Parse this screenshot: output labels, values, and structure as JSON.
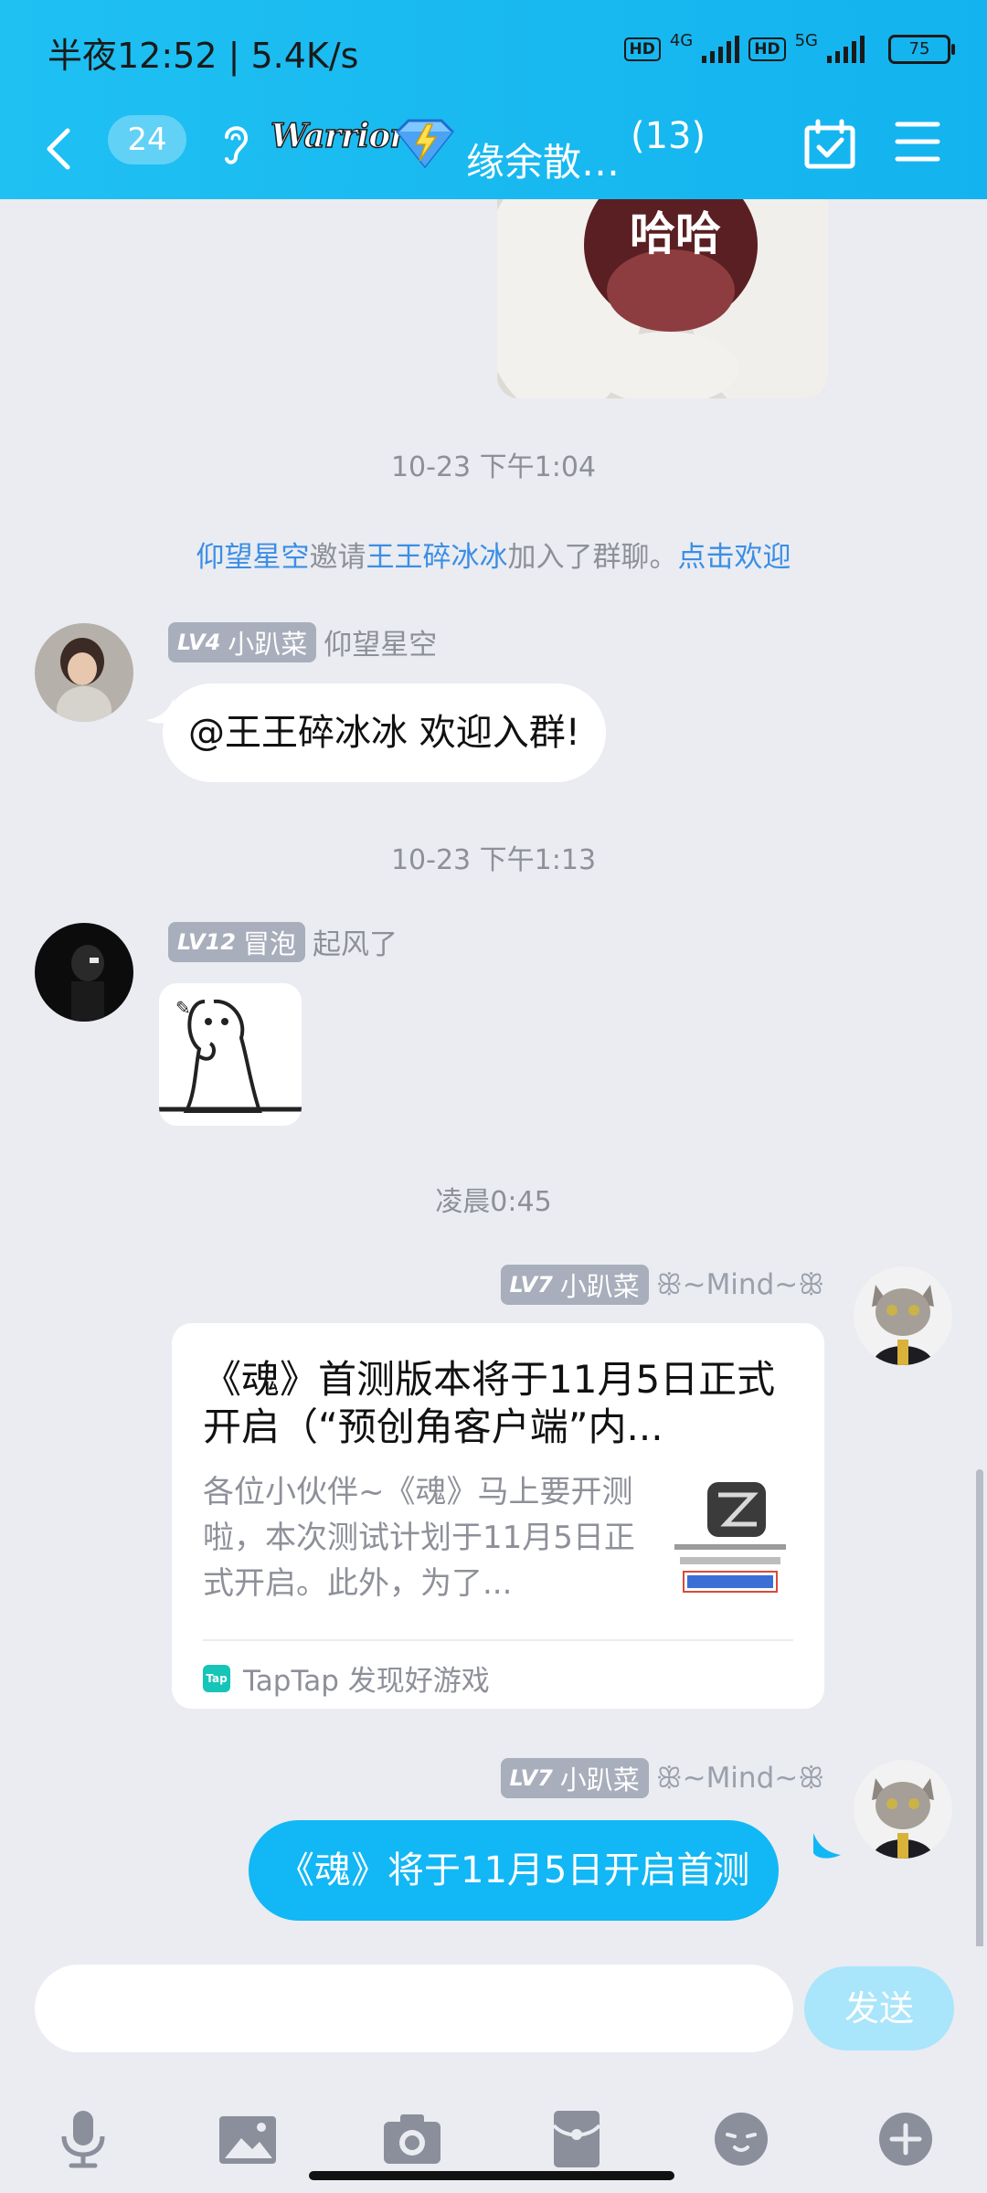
{
  "status_bar": {
    "time": "半夜12:52 | 5.4K/s",
    "hd1": "HD",
    "net1": "4G",
    "hd2": "HD",
    "net2": "5G",
    "battery": "75"
  },
  "header": {
    "unread_count": "24",
    "logo_text": "Warrior",
    "title": "缘余散…",
    "member_count": "(13)"
  },
  "chat": {
    "top_image_caption": "哈哈",
    "timestamp_1": "10-23 下午1:04",
    "system_notice": {
      "inviter": "仰望星空",
      "verb": "邀请",
      "invitee": "王王碎冰冰",
      "suffix": "加入了群聊。",
      "welcome_link": "点击欢迎"
    },
    "msg1": {
      "level": "LV4",
      "title": "小趴菜",
      "sender": "仰望星空",
      "text": "@王王碎冰冰 欢迎入群!"
    },
    "timestamp_2": "10-23 下午1:13",
    "msg2": {
      "level": "LV12",
      "title": "冒泡",
      "sender": "起风了"
    },
    "timestamp_3": "凌晨0:45",
    "msg3": {
      "level": "LV7",
      "title": "小趴菜",
      "sender": "Mind",
      "card_title": "《魂》首测版本将于11月5日正式开启（“预创角客户端”内...",
      "card_desc": "各位小伙伴~《魂》马上要开测啦，本次测试计划于11月5日正式开启。此外，为了...",
      "card_source": "TapTap 发现好游戏",
      "tap_logo": "Tap"
    },
    "msg4": {
      "level": "LV7",
      "title": "小趴菜",
      "sender": "Mind",
      "text": "《魂》将于11月5日开启首测"
    }
  },
  "input": {
    "placeholder": "",
    "send_label": "发送"
  },
  "colors": {
    "header": "#13b3ef",
    "own_bubble": "#12b7f5",
    "link": "#3b8ee5",
    "background": "#eaecf1"
  }
}
